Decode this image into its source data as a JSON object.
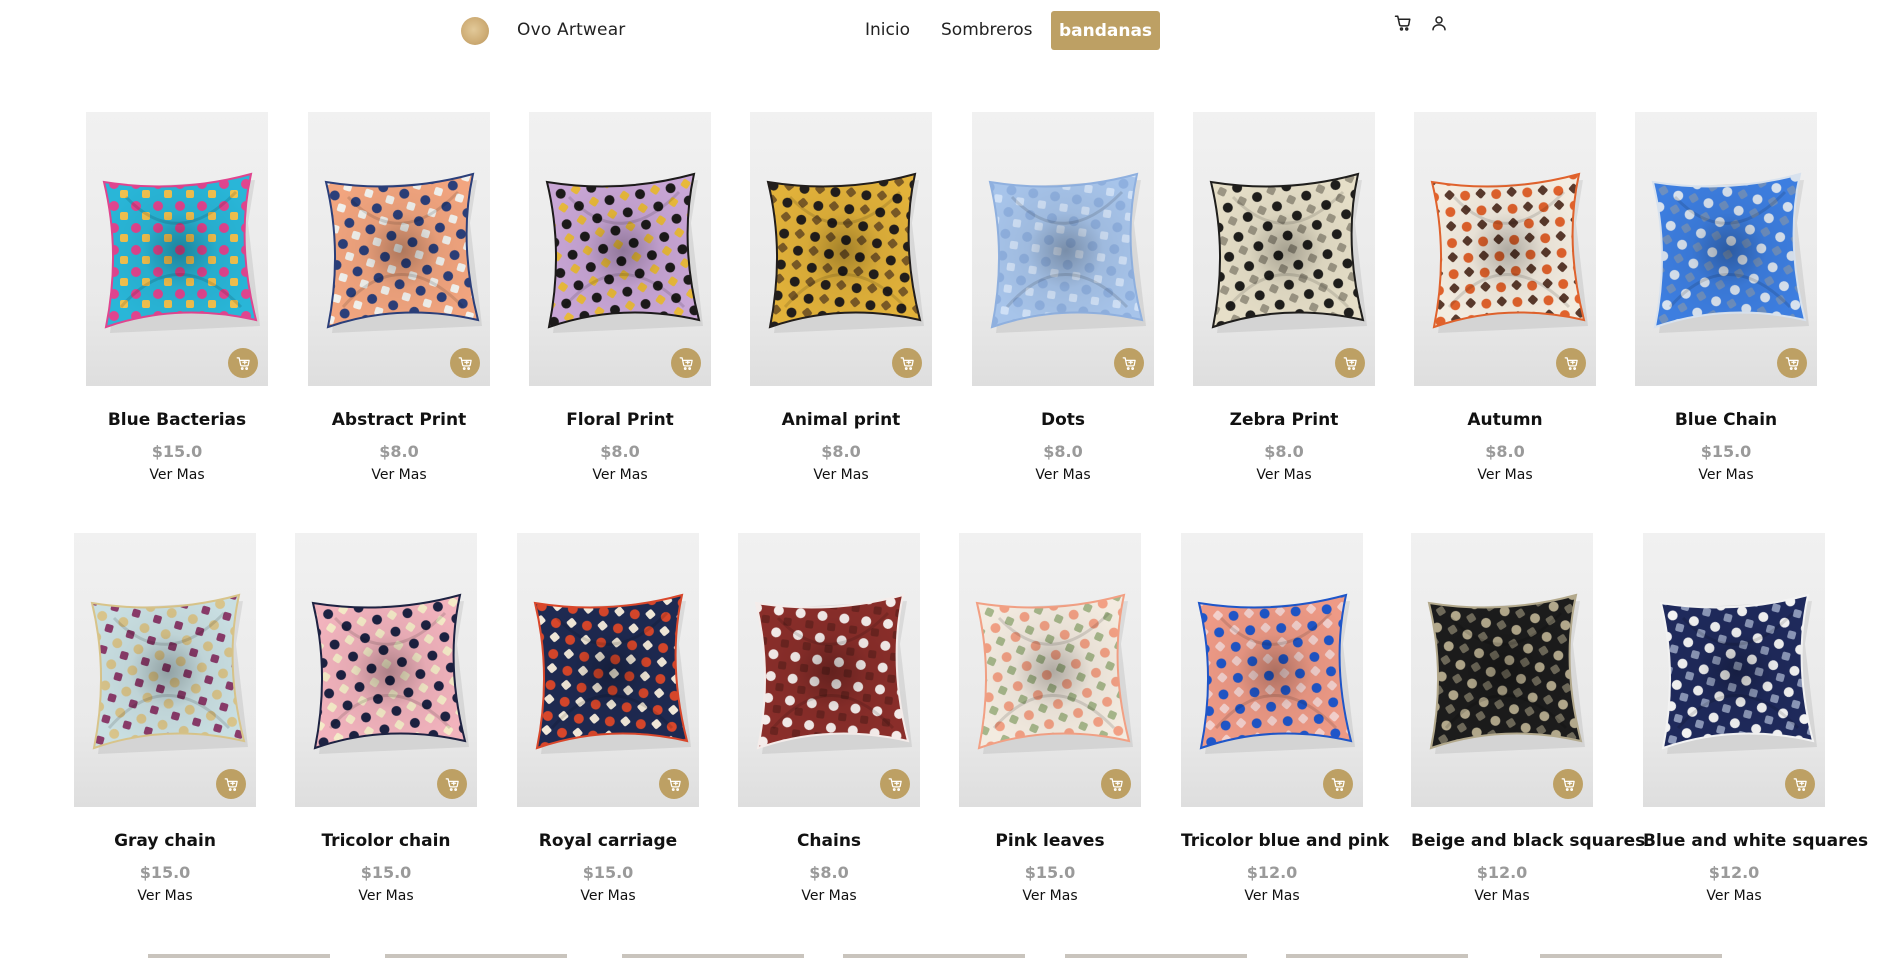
{
  "header": {
    "brand": "Ovo Artwear",
    "nav": [
      "Inicio",
      "Sombreros",
      "bandanas"
    ]
  },
  "accent_color": "#bda064",
  "products": [
    {
      "name": "Blue Bacterias",
      "price": "$15.0",
      "more": "Ver Mas",
      "colors": [
        "#29b6d8",
        "#e0458f",
        "#f2c14e"
      ]
    },
    {
      "name": "Abstract Print",
      "price": "$8.0",
      "more": "Ver Mas",
      "colors": [
        "#f2a57f",
        "#2b3f7a",
        "#f2f2ee"
      ]
    },
    {
      "name": "Floral Print",
      "price": "$8.0",
      "more": "Ver Mas",
      "colors": [
        "#c9a6d6",
        "#1c1a1a",
        "#e8b93b"
      ]
    },
    {
      "name": "Animal print",
      "price": "$8.0",
      "more": "Ver Mas",
      "colors": [
        "#e2b23a",
        "#221e1c",
        "#7a5a26"
      ]
    },
    {
      "name": "Dots",
      "price": "$8.0",
      "more": "Ver Mas",
      "colors": [
        "#a7c4ea",
        "#8fb0df",
        "#cfe0f6"
      ]
    },
    {
      "name": "Zebra Print",
      "price": "$8.0",
      "more": "Ver Mas",
      "colors": [
        "#e6dfc8",
        "#1f1e1c",
        "#9c9684"
      ]
    },
    {
      "name": "Autumn",
      "price": "$8.0",
      "more": "Ver Mas",
      "colors": [
        "#f3ece0",
        "#e0622c",
        "#5a3a2c"
      ]
    },
    {
      "name": "Blue Chain",
      "price": "$15.0",
      "more": "Ver Mas",
      "colors": [
        "#3d7ee0",
        "#d8e2ee",
        "#6d8fbf"
      ]
    },
    {
      "name": "Gray chain",
      "price": "$15.0",
      "more": "Ver Mas",
      "colors": [
        "#c9dfe2",
        "#d8c48a",
        "#8a3b6a"
      ]
    },
    {
      "name": "Tricolor chain",
      "price": "$15.0",
      "more": "Ver Mas",
      "colors": [
        "#f2b3bd",
        "#1d2242",
        "#f5ebc8"
      ]
    },
    {
      "name": "Royal carriage",
      "price": "$15.0",
      "more": "Ver Mas",
      "colors": [
        "#1e2a52",
        "#d9472b",
        "#f3eadb"
      ]
    },
    {
      "name": "Chains",
      "price": "$8.0",
      "more": "Ver Mas",
      "colors": [
        "#8a2e2a",
        "#f4ecea",
        "#6b2420"
      ]
    },
    {
      "name": "Pink leaves",
      "price": "$15.0",
      "more": "Ver Mas",
      "colors": [
        "#f3ebe0",
        "#f2a084",
        "#a6b68a"
      ]
    },
    {
      "name": "Tricolor blue and pink",
      "price": "$12.0",
      "more": "Ver Mas",
      "colors": [
        "#ee9a86",
        "#1f56c9",
        "#f3d0cc"
      ]
    },
    {
      "name": "Beige and black squares",
      "price": "$12.0",
      "more": "Ver Mas",
      "colors": [
        "#1c1c1c",
        "#b3a98c",
        "#6f6a5a"
      ]
    },
    {
      "name": "Blue and white squares",
      "price": "$12.0",
      "more": "Ver Mas",
      "colors": [
        "#1f2a5c",
        "#f3f3f3",
        "#8b97b8"
      ]
    }
  ]
}
